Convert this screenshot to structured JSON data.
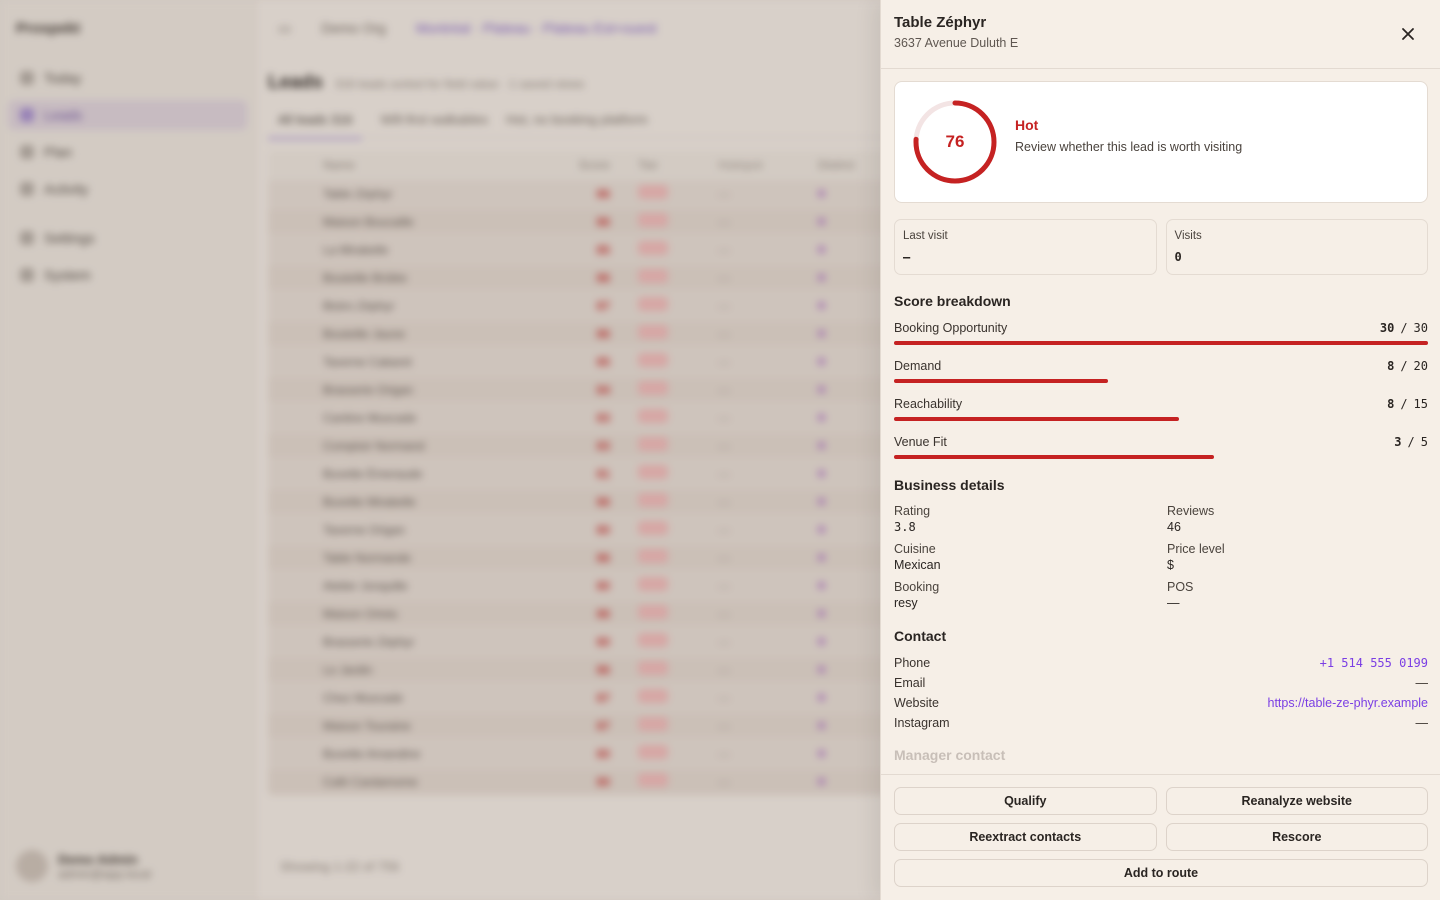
{
  "background": {
    "brand": "Prospekt",
    "nav": [
      {
        "label": "Today"
      },
      {
        "label": "Leads"
      },
      {
        "label": "Plan"
      },
      {
        "label": "Activity"
      },
      {
        "label": "Settings"
      },
      {
        "label": "System"
      }
    ],
    "user": {
      "name": "Demo Admin",
      "email": "admin@app.local"
    },
    "breadcrumb": {
      "org": "Demo Org",
      "region": "Montréal · Plateau · Plateau Est+ouest"
    },
    "title": "Leads",
    "subtitle": "316 leads sorted for field value · 1 saved views",
    "tabs": [
      "All leads 316",
      "Wifi-first walkables",
      "Hot, no booking platform"
    ],
    "columns": [
      "Name",
      "Score",
      "Tier",
      "Hubspot",
      "District"
    ],
    "rows": [
      {
        "name": "Table Zéphyr",
        "score": "86"
      },
      {
        "name": "Maison Boucaille",
        "score": "86"
      },
      {
        "name": "La Mirabelle",
        "score": "85"
      },
      {
        "name": "Bouteille Brûlée",
        "score": "86"
      },
      {
        "name": "Bistro Zéphyr",
        "score": "87"
      },
      {
        "name": "Bouteille Jaune",
        "score": "86"
      },
      {
        "name": "Taverne Cabaret",
        "score": "85"
      },
      {
        "name": "Brasserie Origan",
        "score": "84"
      },
      {
        "name": "Cantine Muscade",
        "score": "83"
      },
      {
        "name": "Comptoir Normand",
        "score": "83"
      },
      {
        "name": "Buvette Émeraude",
        "score": "81"
      },
      {
        "name": "Buvette Mirabelle",
        "score": "86"
      },
      {
        "name": "Taverne Origan",
        "score": "80"
      },
      {
        "name": "Table Normande",
        "score": "86"
      },
      {
        "name": "Atelier Jonquille",
        "score": "80"
      },
      {
        "name": "Maison Ortolu",
        "score": "86"
      },
      {
        "name": "Brasserie Zéphyr",
        "score": "80"
      },
      {
        "name": "Le Jardin",
        "score": "86"
      },
      {
        "name": "Chez Muscade",
        "score": "87"
      },
      {
        "name": "Maison Touraine",
        "score": "87"
      },
      {
        "name": "Buvette Amandine",
        "score": "80"
      },
      {
        "name": "Café Cardamome",
        "score": "80"
      }
    ],
    "footer": "Showing 1-22 of 756"
  },
  "panel": {
    "name": "Table Zéphyr",
    "address": "3637 Avenue Duluth E",
    "score": {
      "value": 76,
      "max": 100,
      "tier": "Hot",
      "description": "Review whether this lead is worth visiting"
    },
    "stats": [
      {
        "label": "Last visit",
        "value": "—"
      },
      {
        "label": "Visits",
        "value": "0"
      }
    ],
    "breakdown_title": "Score breakdown",
    "breakdown": [
      {
        "label": "Booking Opportunity",
        "score": 30,
        "max": 30
      },
      {
        "label": "Demand",
        "score": 8,
        "max": 20
      },
      {
        "label": "Reachability",
        "score": 8,
        "max": 15
      },
      {
        "label": "Venue Fit",
        "score": 3,
        "max": 5
      }
    ],
    "details_title": "Business details",
    "details": {
      "rating": {
        "label": "Rating",
        "value": "3.8"
      },
      "reviews": {
        "label": "Reviews",
        "value": "46"
      },
      "cuisine": {
        "label": "Cuisine",
        "value": "Mexican"
      },
      "price": {
        "label": "Price level",
        "value": "$"
      },
      "booking": {
        "label": "Booking",
        "value": "resy"
      },
      "pos": {
        "label": "POS",
        "value": "—"
      }
    },
    "contact_title": "Contact",
    "contact": {
      "phone": {
        "label": "Phone",
        "value": "+1 514 555 0199"
      },
      "email": {
        "label": "Email",
        "value": "—"
      },
      "website": {
        "label": "Website",
        "value": "https://table-ze-phyr.example"
      },
      "instagram": {
        "label": "Instagram",
        "value": "—"
      }
    },
    "next_section_title": "Manager contact",
    "actions": {
      "qualify": "Qualify",
      "reanalyze": "Reanalyze website",
      "reextract": "Reextract contacts",
      "rescore": "Rescore",
      "add_route": "Add to route"
    },
    "colors": {
      "accent": "#c52222",
      "link": "#7b3fe4",
      "panel_bg": "#f6efe7"
    }
  }
}
